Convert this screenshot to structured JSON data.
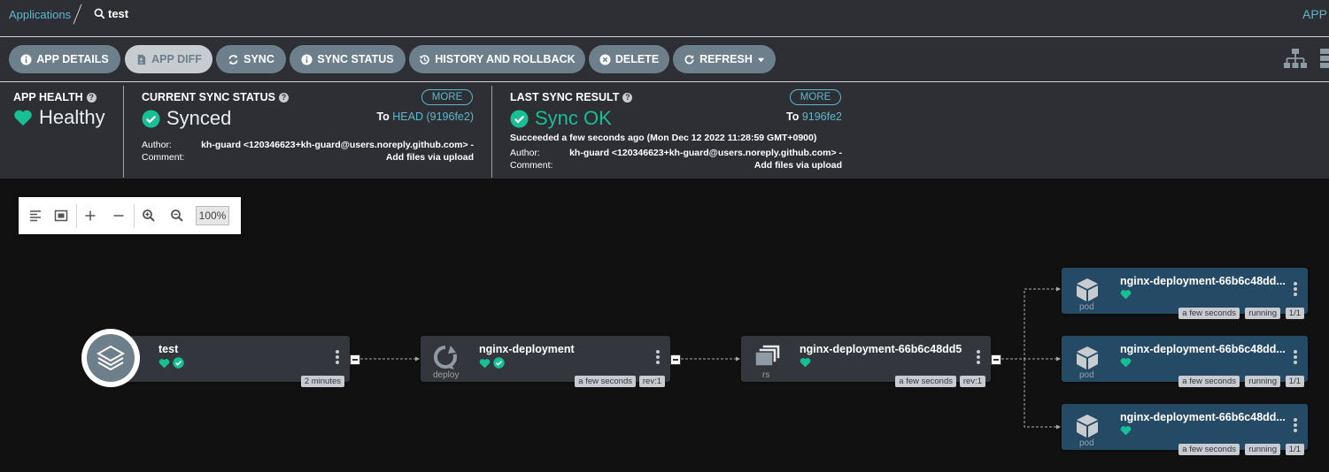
{
  "breadcrumb": {
    "root": "Applications",
    "current": "test"
  },
  "header_right": "APP",
  "toolbar": {
    "buttons": [
      {
        "label": "APP DETAILS",
        "icon": "info-icon"
      },
      {
        "label": "APP DIFF",
        "icon": "file-diff-icon"
      },
      {
        "label": "SYNC",
        "icon": "sync-icon"
      },
      {
        "label": "SYNC STATUS",
        "icon": "info-icon"
      },
      {
        "label": "HISTORY AND ROLLBACK",
        "icon": "history-icon"
      },
      {
        "label": "DELETE",
        "icon": "delete-icon"
      },
      {
        "label": "REFRESH",
        "icon": "refresh-icon"
      }
    ]
  },
  "status": {
    "app_health": {
      "label": "APP HEALTH",
      "value": "Healthy"
    },
    "current_sync": {
      "label": "CURRENT SYNC STATUS",
      "value": "Synced",
      "more": "MORE",
      "to_prefix": "To",
      "to_rev": "HEAD (9196fe2)",
      "author_label": "Author:",
      "author": "kh-guard <120346623+kh-guard@users.noreply.github.com> -",
      "comment_label": "Comment:",
      "comment": "Add files via upload"
    },
    "last_sync": {
      "label": "LAST SYNC RESULT",
      "value": "Sync OK",
      "more": "MORE",
      "to_prefix": "To",
      "to_rev": "9196fe2",
      "succeeded": "Succeeded a few seconds ago (Mon Dec 12 2022 11:28:59 GMT+0900)",
      "author_label": "Author:",
      "author": "kh-guard <120346623+kh-guard@users.noreply.github.com> -",
      "comment_label": "Comment:",
      "comment": "Add files via upload"
    }
  },
  "zoom": {
    "value": "100%"
  },
  "nodes": {
    "app": {
      "name": "test",
      "age": "2 minutes"
    },
    "deploy": {
      "name": "nginx-deployment",
      "kind": "deploy",
      "age": "a few seconds",
      "rev": "rev:1"
    },
    "rs": {
      "name": "nginx-deployment-66b6c48dd5",
      "kind": "rs",
      "age": "a few seconds",
      "rev": "rev:1"
    },
    "pods": [
      {
        "name": "nginx-deployment-66b6c48dd...",
        "kind": "pod",
        "age": "a few seconds",
        "status": "running",
        "ready": "1/1"
      },
      {
        "name": "nginx-deployment-66b6c48dd...",
        "kind": "pod",
        "age": "a few seconds",
        "status": "running",
        "ready": "1/1"
      },
      {
        "name": "nginx-deployment-66b6c48dd...",
        "kind": "pod",
        "age": "a few seconds",
        "status": "running",
        "ready": "1/1"
      }
    ]
  },
  "colors": {
    "accent": "#5eb7cc",
    "healthy": "#18be94",
    "synced": "#18be94",
    "button": "#6d7f8b",
    "pod_node": "#254a66"
  }
}
